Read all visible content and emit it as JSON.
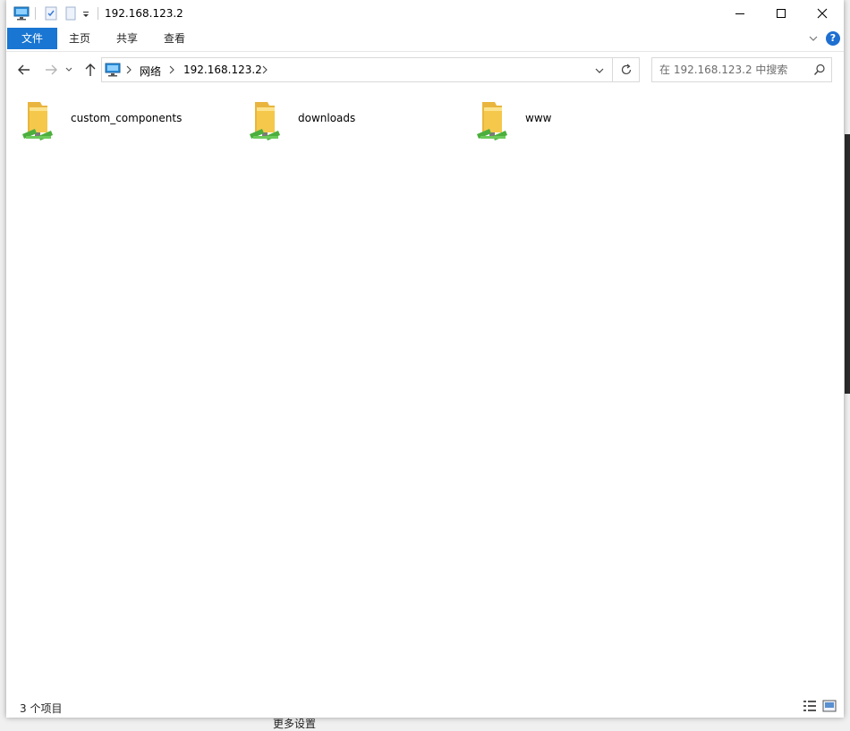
{
  "window": {
    "title": "192.168.123.2"
  },
  "ribbon": {
    "tabs": [
      {
        "label": "文件",
        "active": true
      },
      {
        "label": "主页",
        "active": false
      },
      {
        "label": "共享",
        "active": false
      },
      {
        "label": "查看",
        "active": false
      }
    ],
    "help_label": "?"
  },
  "address": {
    "segments": [
      "网络",
      "192.168.123.2"
    ]
  },
  "search": {
    "placeholder": "在 192.168.123.2 中搜索"
  },
  "items": [
    {
      "name": "custom_components",
      "icon": "network-folder-icon"
    },
    {
      "name": "downloads",
      "icon": "network-folder-icon"
    },
    {
      "name": "www",
      "icon": "network-folder-icon"
    }
  ],
  "status": {
    "item_count": "3 个项目"
  },
  "background": {
    "partial_text": "更多设置"
  },
  "colors": {
    "accent": "#1976d2",
    "help": "#1e6fd0",
    "folder": "#f5c84c",
    "share_badge": "#4caf3d"
  }
}
